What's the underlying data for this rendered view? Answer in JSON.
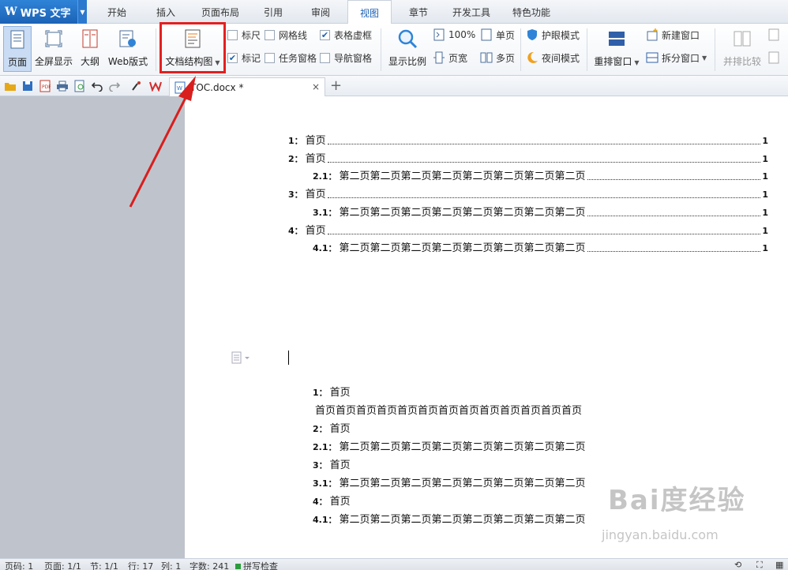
{
  "app": {
    "name": "WPS 文字",
    "logo": "W"
  },
  "menu": {
    "tabs": [
      "开始",
      "插入",
      "页面布局",
      "引用",
      "审阅",
      "视图",
      "章节",
      "开发工具",
      "特色功能"
    ],
    "active": "视图"
  },
  "ribbon": {
    "page_view": "页面",
    "fullscreen": "全屏显示",
    "outline": "大纲",
    "web_layout": "Web版式",
    "doc_map": "文档结构图",
    "ruler": "标尺",
    "gridlines": "网格线",
    "table_gridlines": "表格虚框",
    "marks": "标记",
    "task_pane": "任务窗格",
    "nav_pane": "导航窗格",
    "zoom": "显示比例",
    "zoom_100": "100%",
    "page_width": "页宽",
    "one_page": "单页",
    "multi_page": "多页",
    "eye_care": "护眼模式",
    "night_mode": "夜间模式",
    "arrange": "重排窗口",
    "new_window": "新建窗口",
    "split_window": "拆分窗口",
    "side_by_side": "并排比较",
    "checkbox_states": {
      "ruler": false,
      "gridlines": false,
      "table_gridlines": true,
      "marks": true,
      "task_pane": false,
      "nav_pane": false
    }
  },
  "doc_tab": {
    "name": "TOC.docx *",
    "close": "×",
    "new": "+"
  },
  "toc": [
    {
      "num": "1：",
      "text": "首页",
      "page": "1"
    },
    {
      "num": "2：",
      "text": "首页",
      "page": "1"
    },
    {
      "num": "2.1：",
      "text": "第二页第二页第二页第二页第二页第二页第二页第二页",
      "page": "1"
    },
    {
      "num": "3：",
      "text": "首页",
      "page": "1"
    },
    {
      "num": "3.1：",
      "text": "第二页第二页第二页第二页第二页第二页第二页第二页",
      "page": "1"
    },
    {
      "num": "4：",
      "text": "首页",
      "page": "1"
    },
    {
      "num": "4.1：",
      "text": "第二页第二页第二页第二页第二页第二页第二页第二页",
      "page": "1"
    }
  ],
  "body": [
    {
      "num": "1：",
      "text": "首页"
    },
    {
      "num": "",
      "text": "首页首页首页首页首页首页首页首页首页首页首页首页首页"
    },
    {
      "num": "2：",
      "text": "首页"
    },
    {
      "num": "2.1：",
      "text": "第二页第二页第二页第二页第二页第二页第二页第二页"
    },
    {
      "num": "3：",
      "text": "首页"
    },
    {
      "num": "3.1：",
      "text": "第二页第二页第二页第二页第二页第二页第二页第二页"
    },
    {
      "num": "4：",
      "text": "首页"
    },
    {
      "num": "4.1：",
      "text": "第二页第二页第二页第二页第二页第二页第二页第二页"
    }
  ],
  "status": {
    "page_num": "页码: 1",
    "pages": "页面: 1/1",
    "section": "节: 1/1",
    "line": "行: 17",
    "column": "列: 1",
    "word_count": "字数: 241",
    "spell_check": "拼写检查"
  },
  "watermark": {
    "main": "Bai度经验",
    "sub": "jingyan.baidu.com"
  },
  "colors": {
    "accent": "#1b62b5",
    "highlight": "#e32020",
    "sidebar": "#bfc4cc"
  }
}
